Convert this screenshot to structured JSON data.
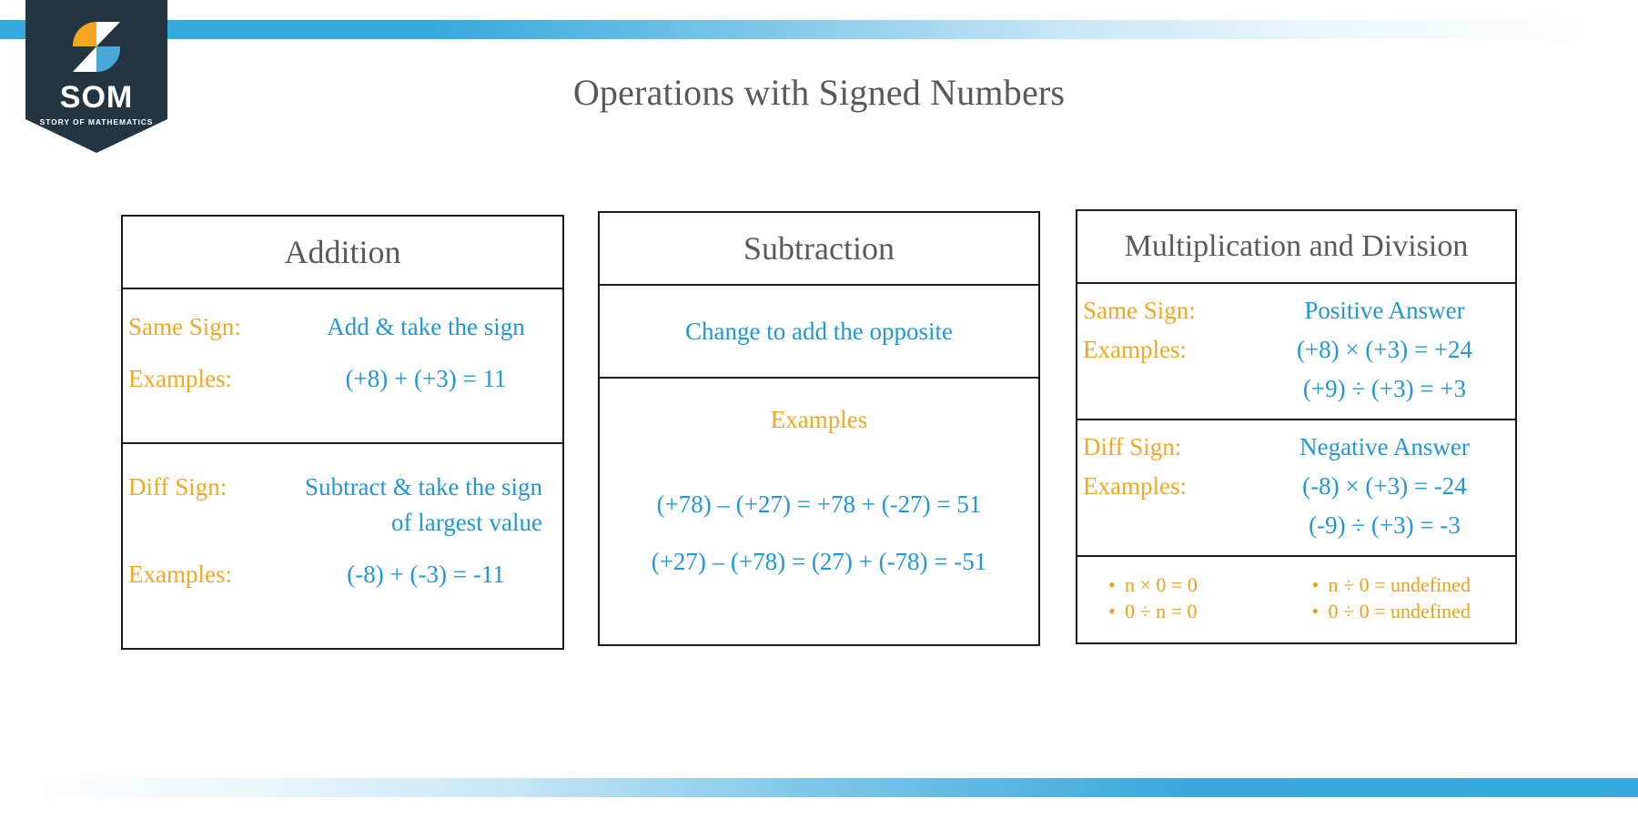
{
  "brand": {
    "wordmark": "SOM",
    "tagline": "STORY OF MATHEMATICS",
    "colors": {
      "banner": "#233542",
      "orange": "#f5a623",
      "blue": "#35a8dd",
      "white": "#ffffff"
    }
  },
  "page": {
    "title": "Operations with Signed Numbers",
    "title_color": "#595959",
    "accent_bar_color": "#35a8dd"
  },
  "tables": [
    {
      "header": "Addition",
      "sections": [
        {
          "rows": [
            {
              "label": "Same Sign:",
              "value": "Add & take the sign"
            },
            {
              "label": "Examples:",
              "value": "(+8) + (+3) = 11"
            }
          ]
        },
        {
          "rows": [
            {
              "label": "Diff Sign:",
              "value": "Subtract & take the sign",
              "value2": "of largest value"
            },
            {
              "label": "Examples:",
              "value": "(-8) + (-3) = -11"
            }
          ]
        }
      ]
    },
    {
      "header": "Subtraction",
      "rule": "Change to add the opposite",
      "examples_label": "Examples",
      "examples": [
        "(+78) – (+27) = +78 + (-27) = 51",
        "(+27) – (+78) = (27) + (-78) = -51"
      ]
    },
    {
      "header": "Multiplication and Division",
      "sections": [
        {
          "rows": [
            {
              "label": "Same Sign:",
              "value": "Positive Answer"
            },
            {
              "label": "Examples:",
              "value": "(+8) × (+3) = +24",
              "value2": "(+9) ÷ (+3) = +3"
            }
          ]
        },
        {
          "rows": [
            {
              "label": "Diff Sign:",
              "value": "Negative Answer"
            },
            {
              "label": "Examples:",
              "value": "(-8) × (+3) = -24",
              "value2": "(-9) ÷ (+3) = -3"
            }
          ]
        }
      ],
      "zero_rules_left": [
        "n × 0 = 0",
        "0 ÷ n = 0"
      ],
      "zero_rules_right": [
        "n ÷ 0 = undefined",
        "0 ÷ 0 = undefined"
      ]
    }
  ]
}
